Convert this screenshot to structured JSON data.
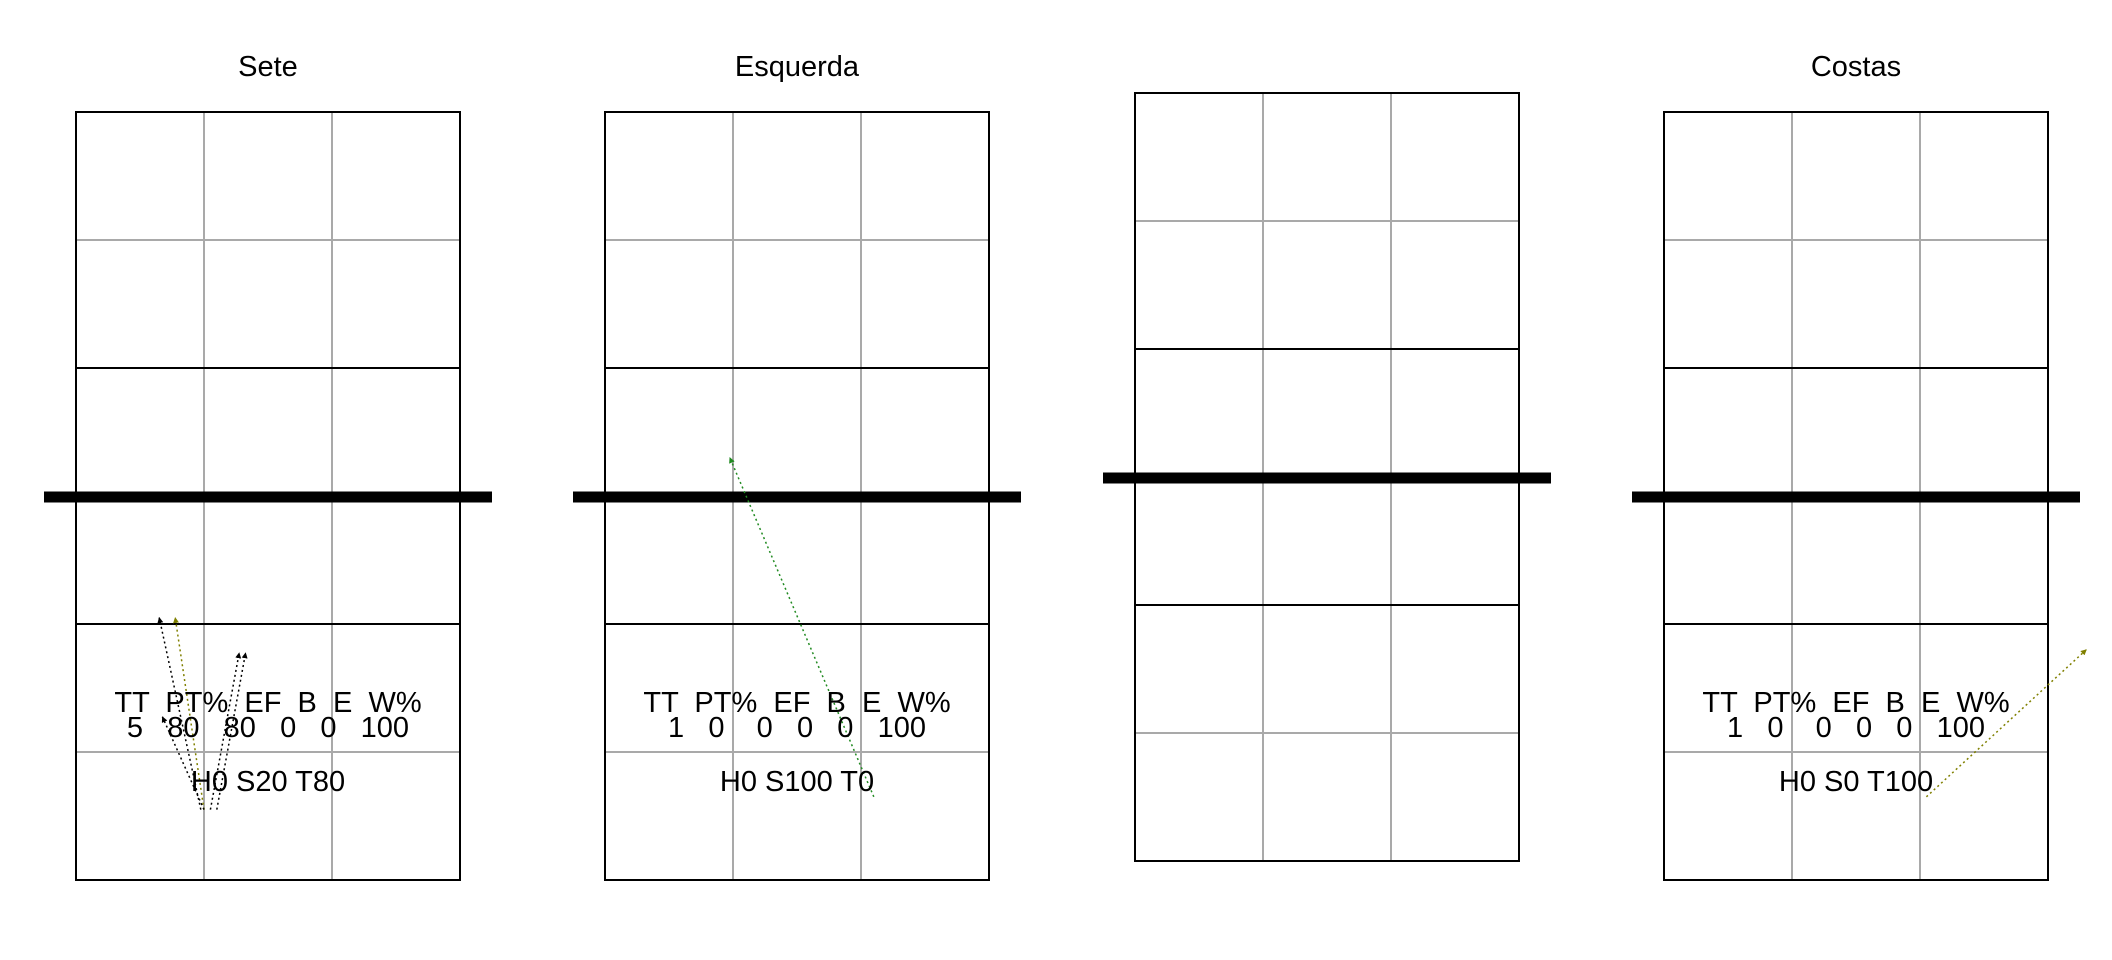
{
  "colors": {
    "net": "#000000",
    "grid_major": "#000000",
    "grid_minor": "#a9a9a9",
    "arrow_black": "#000000",
    "arrow_olive": "#808000",
    "arrow_green": "#228b22"
  },
  "chart_data": [
    {
      "type": "other",
      "title": "Sete",
      "stats_header": "TT  PT%  EF  B  E  W%",
      "stats_values": "5   80   80   0   0   100",
      "distribution": "H0 S20 T80",
      "arrows": [
        {
          "from": [
            1.95,
            1.1
          ],
          "to": [
            1.3,
            4.1
          ],
          "color": "arrow_black"
        },
        {
          "from": [
            2.0,
            1.1
          ],
          "to": [
            1.55,
            4.1
          ],
          "color": "arrow_olive"
        },
        {
          "from": [
            2.1,
            1.1
          ],
          "to": [
            2.55,
            3.55
          ],
          "color": "arrow_black"
        },
        {
          "from": [
            2.2,
            1.1
          ],
          "to": [
            2.65,
            3.55
          ],
          "color": "arrow_black"
        },
        {
          "from": [
            2.0,
            1.1
          ],
          "to": [
            1.35,
            2.55
          ],
          "color": "arrow_black"
        }
      ]
    },
    {
      "type": "other",
      "title": "Esquerda",
      "stats_header": "TT  PT%  EF  B  E  W%",
      "stats_values": "1   0    0   0   0   100",
      "distribution": "H0 S100 T0",
      "arrows": [
        {
          "from": [
            4.2,
            1.3
          ],
          "to": [
            1.95,
            6.6
          ],
          "color": "arrow_green"
        }
      ]
    },
    {
      "type": "other",
      "title": "",
      "stats_header": "",
      "stats_values": "",
      "distribution": "",
      "arrows": []
    },
    {
      "type": "other",
      "title": "Costas",
      "stats_header": "TT  PT%  EF  B  E  W%",
      "stats_values": "1   0    0   0   0   100",
      "distribution": "H0 S0 T100",
      "arrows": [
        {
          "from": [
            4.1,
            1.3
          ],
          "to": [
            6.6,
            3.6
          ],
          "color": "arrow_olive"
        }
      ]
    }
  ]
}
